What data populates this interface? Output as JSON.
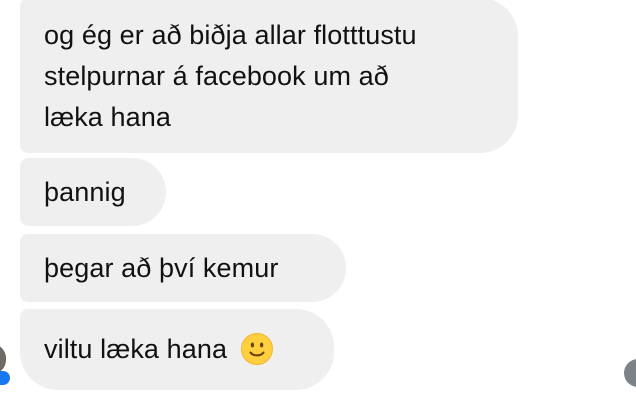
{
  "messages": [
    {
      "lines": [
        "og ég er að biðja allar flotttustu",
        "stelpurnar á facebook um að",
        "læka hana"
      ]
    },
    {
      "text": "þannig"
    },
    {
      "text": "þegar að því kemur"
    },
    {
      "text": "viltu læka hana",
      "emoji": "slightly-smiling-face-icon"
    }
  ],
  "colors": {
    "bubble": "#efefef",
    "text": "#111111",
    "badge": "#1877f2",
    "emoji_face": "#ffcf3f",
    "emoji_features": "#6a4200"
  }
}
